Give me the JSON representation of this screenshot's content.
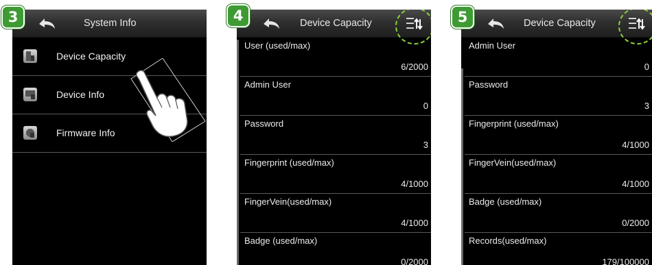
{
  "steps": [
    "3",
    "4",
    "5"
  ],
  "screen3": {
    "title": "System Info",
    "items": [
      {
        "label": "Device Capacity",
        "icon": "device-capacity-icon"
      },
      {
        "label": "Device Info",
        "icon": "device-info-icon"
      },
      {
        "label": "Firmware Info",
        "icon": "firmware-info-icon"
      }
    ]
  },
  "screen4": {
    "title": "Device Capacity",
    "rows": [
      {
        "label": "User (used/max)",
        "value": "6/2000"
      },
      {
        "label": "Admin User",
        "value": "0"
      },
      {
        "label": "Password",
        "value": "3"
      },
      {
        "label": "Fingerprint (used/max)",
        "value": "4/1000"
      },
      {
        "label": "FingerVein(used/max)",
        "value": "4/1000"
      },
      {
        "label": "Badge (used/max)",
        "value": "0/2000"
      }
    ]
  },
  "screen5": {
    "title": "Device Capacity",
    "rows": [
      {
        "label": "Admin User",
        "value": "0"
      },
      {
        "label": "Password",
        "value": "3"
      },
      {
        "label": "Fingerprint (used/max)",
        "value": "4/1000"
      },
      {
        "label": "FingerVein(used/max)",
        "value": "4/1000"
      },
      {
        "label": "Badge (used/max)",
        "value": "0/2000"
      },
      {
        "label": "Records(used/max)",
        "value": "179/100000"
      }
    ]
  },
  "colors": {
    "step_badge": "#3e9b33",
    "highlight_dash": "#8ad23a"
  }
}
